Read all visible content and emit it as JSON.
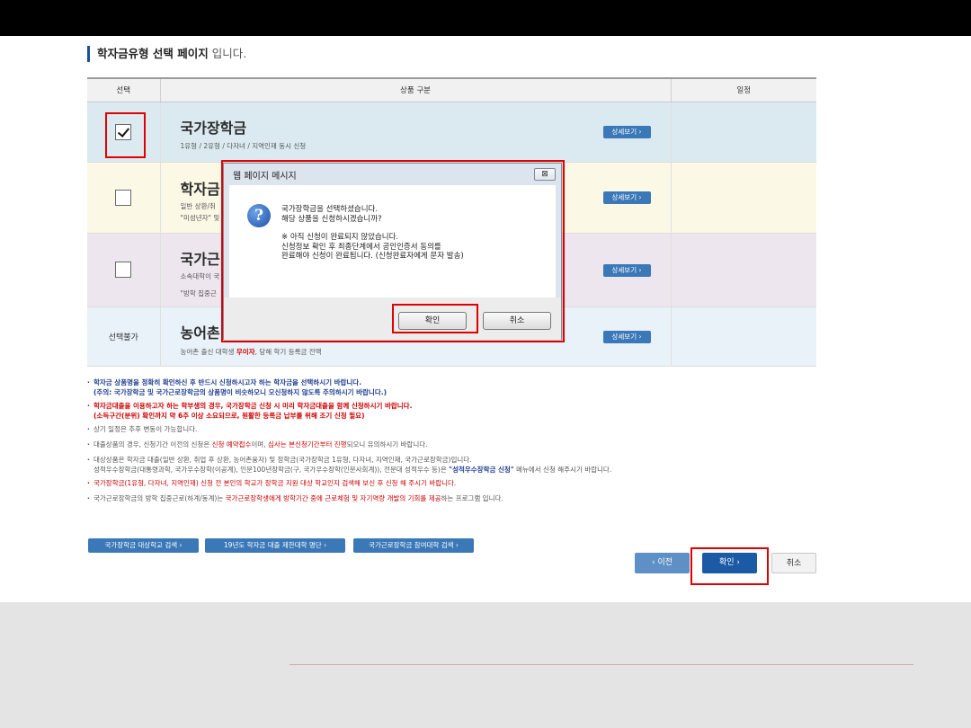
{
  "page": {
    "title_bold": "학자금유형 선택 페이지",
    "title_rest": "입니다."
  },
  "table": {
    "headers": [
      "선택",
      "상품 구분",
      "일정"
    ],
    "rows": [
      {
        "name": "국가장학금",
        "desc1": "1유형 / 2유형 / 다자녀 / 지역인재 동시 신청",
        "desc2": "",
        "detail": "상세보기 ›",
        "checked": true
      },
      {
        "name": "학자금",
        "desc1": "일반 상환/취",
        "desc2": "\"미성년자\" 및",
        "detail": "상세보기 ›",
        "checked": false
      },
      {
        "name": "국가근",
        "desc1": "소속대학이 국",
        "desc2": "\"방학 집중근",
        "detail": "상세보기 ›",
        "checked": false
      },
      {
        "name": "농어촌",
        "desc1_a": "농어촌 출신 대학생 ",
        "desc1_red": "무이자",
        "desc1_b": ", 당해 학기 등록금 전액",
        "detail": "상세보기 ›",
        "select_label": "선택불가"
      }
    ]
  },
  "dialog": {
    "title": "웹 페이지 메시지",
    "close": "⊠",
    "line1": "국가장학금을 선택하셨습니다.",
    "line2": "해당 상품을 신청하시겠습니까?",
    "line3": "※ 아직 신청이 완료되지 않았습니다.",
    "line4": "신청정보 확인 후 최종단계에서 공인인증서 동의를",
    "line5": "완료해야 신청이 완료됩니다. (신청완료자에게 문자 발송)",
    "ok": "확인",
    "cancel": "취소"
  },
  "notes": {
    "n1a": "학자금 상품명을 정확히 확인하신 후 반드시 신청하시고자 하는 학자금을 선택하시기 바랍니다.",
    "n1b": "(주의: 국가장학금 및 국가근로장학금의 상품명이 비슷하오니 오신청하지 않도록 주의하시기 바랍니다.)",
    "n2a": "학자금대출을 이용하고자 하는 학부생의 경우, 국가장학금 신청 시 미리 학자금대출을 함께 신청하시기 바랍니다.",
    "n2b": "(소득구간(분위) 확인까지 약 6주 이상 소요되므로, 원활한 등록금 납부를 위해 조기 신청 필요)",
    "n3": "상기 일정은 추후 변동이 가능합니다.",
    "n4a": "대출상품의 경우, 신청기간 이전의 신청은 ",
    "n4red1": "신청 예약접수",
    "n4b": "이며, ",
    "n4red2": "심사는 본신청기간부터 진행",
    "n4c": "되오니 유의하시기 바랍니다.",
    "n5a": "대상상품은 학자금 대출(일반 상환, 취업 후 상환, 농어촌융자) 및 장학금(국가장학금 1유형, 다자녀, 지역인재, 국가근로장학금)입니다.",
    "n5b": "성적우수장학금(대통령과학, 국가우수장학(이공계), 인문100년장학금(구, 국가우수장학(인문사회계)), 전문대 성적우수 등)은 ",
    "n5blue": "\"성적우수장학금 신청\"",
    "n5c": " 메뉴에서 신청 해주시기 바랍니다.",
    "n6": "국가장학금(1유형, 다자녀, 지역인재) 신청 전 본인의 학교가 장학금 지원 대상 학교인지 검색해 보신 후 신청 해 주시기 바랍니다.",
    "n7a": "국가근로장학금의 방학 집중근로(하계/동계)는 ",
    "n7red": "국가근로장학생에게 방학기간 중에 근로체험 및 자기역량 개발의 기회를 제공",
    "n7b": "하는 프로그램 입니다."
  },
  "links": {
    "l1": "국가장학금 대상학교 검색 ›",
    "l2": "19년도 학자금 대출 제한대학 명단 ›",
    "l3": "국가근로장학금 참여대학 검색 ›"
  },
  "nav": {
    "prev": "‹  이전",
    "ok": "확인  ›",
    "cancel": "취소"
  },
  "colors": {
    "highlight_box": "#e00000",
    "button_blue": "#3a78b8",
    "ok_blue": "#1c5aa6"
  }
}
